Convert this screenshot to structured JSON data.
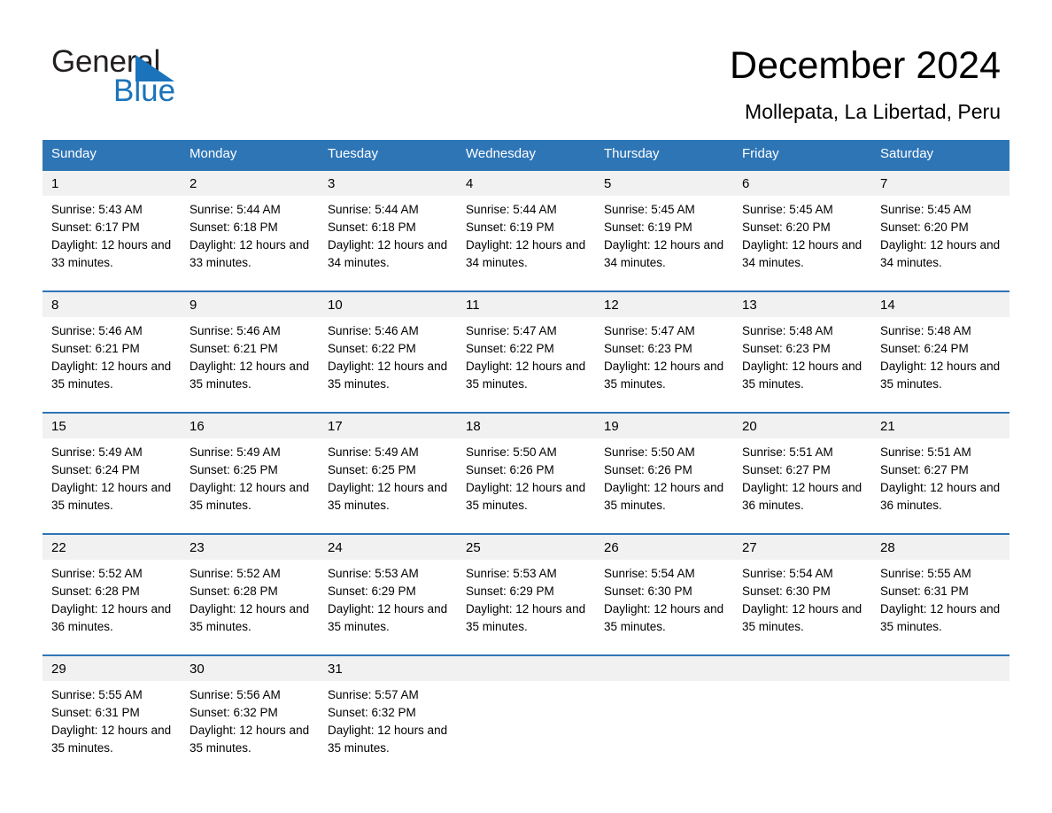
{
  "brand": {
    "name_part1": "General",
    "name_part2": "Blue",
    "triangle_color": "#1b74bb"
  },
  "header": {
    "title": "December 2024",
    "subtitle": "Mollepata, La Libertad, Peru"
  },
  "colors": {
    "header_blue": "#2e75b6",
    "daynum_band": "#f1f1f1",
    "text": "#000000"
  },
  "weekdays": [
    "Sunday",
    "Monday",
    "Tuesday",
    "Wednesday",
    "Thursday",
    "Friday",
    "Saturday"
  ],
  "weeks": [
    {
      "days": [
        {
          "num": "1",
          "sunrise": "Sunrise: 5:43 AM",
          "sunset": "Sunset: 6:17 PM",
          "daylight": "Daylight: 12 hours and 33 minutes."
        },
        {
          "num": "2",
          "sunrise": "Sunrise: 5:44 AM",
          "sunset": "Sunset: 6:18 PM",
          "daylight": "Daylight: 12 hours and 33 minutes."
        },
        {
          "num": "3",
          "sunrise": "Sunrise: 5:44 AM",
          "sunset": "Sunset: 6:18 PM",
          "daylight": "Daylight: 12 hours and 34 minutes."
        },
        {
          "num": "4",
          "sunrise": "Sunrise: 5:44 AM",
          "sunset": "Sunset: 6:19 PM",
          "daylight": "Daylight: 12 hours and 34 minutes."
        },
        {
          "num": "5",
          "sunrise": "Sunrise: 5:45 AM",
          "sunset": "Sunset: 6:19 PM",
          "daylight": "Daylight: 12 hours and 34 minutes."
        },
        {
          "num": "6",
          "sunrise": "Sunrise: 5:45 AM",
          "sunset": "Sunset: 6:20 PM",
          "daylight": "Daylight: 12 hours and 34 minutes."
        },
        {
          "num": "7",
          "sunrise": "Sunrise: 5:45 AM",
          "sunset": "Sunset: 6:20 PM",
          "daylight": "Daylight: 12 hours and 34 minutes."
        }
      ]
    },
    {
      "days": [
        {
          "num": "8",
          "sunrise": "Sunrise: 5:46 AM",
          "sunset": "Sunset: 6:21 PM",
          "daylight": "Daylight: 12 hours and 35 minutes."
        },
        {
          "num": "9",
          "sunrise": "Sunrise: 5:46 AM",
          "sunset": "Sunset: 6:21 PM",
          "daylight": "Daylight: 12 hours and 35 minutes."
        },
        {
          "num": "10",
          "sunrise": "Sunrise: 5:46 AM",
          "sunset": "Sunset: 6:22 PM",
          "daylight": "Daylight: 12 hours and 35 minutes."
        },
        {
          "num": "11",
          "sunrise": "Sunrise: 5:47 AM",
          "sunset": "Sunset: 6:22 PM",
          "daylight": "Daylight: 12 hours and 35 minutes."
        },
        {
          "num": "12",
          "sunrise": "Sunrise: 5:47 AM",
          "sunset": "Sunset: 6:23 PM",
          "daylight": "Daylight: 12 hours and 35 minutes."
        },
        {
          "num": "13",
          "sunrise": "Sunrise: 5:48 AM",
          "sunset": "Sunset: 6:23 PM",
          "daylight": "Daylight: 12 hours and 35 minutes."
        },
        {
          "num": "14",
          "sunrise": "Sunrise: 5:48 AM",
          "sunset": "Sunset: 6:24 PM",
          "daylight": "Daylight: 12 hours and 35 minutes."
        }
      ]
    },
    {
      "days": [
        {
          "num": "15",
          "sunrise": "Sunrise: 5:49 AM",
          "sunset": "Sunset: 6:24 PM",
          "daylight": "Daylight: 12 hours and 35 minutes."
        },
        {
          "num": "16",
          "sunrise": "Sunrise: 5:49 AM",
          "sunset": "Sunset: 6:25 PM",
          "daylight": "Daylight: 12 hours and 35 minutes."
        },
        {
          "num": "17",
          "sunrise": "Sunrise: 5:49 AM",
          "sunset": "Sunset: 6:25 PM",
          "daylight": "Daylight: 12 hours and 35 minutes."
        },
        {
          "num": "18",
          "sunrise": "Sunrise: 5:50 AM",
          "sunset": "Sunset: 6:26 PM",
          "daylight": "Daylight: 12 hours and 35 minutes."
        },
        {
          "num": "19",
          "sunrise": "Sunrise: 5:50 AM",
          "sunset": "Sunset: 6:26 PM",
          "daylight": "Daylight: 12 hours and 35 minutes."
        },
        {
          "num": "20",
          "sunrise": "Sunrise: 5:51 AM",
          "sunset": "Sunset: 6:27 PM",
          "daylight": "Daylight: 12 hours and 36 minutes."
        },
        {
          "num": "21",
          "sunrise": "Sunrise: 5:51 AM",
          "sunset": "Sunset: 6:27 PM",
          "daylight": "Daylight: 12 hours and 36 minutes."
        }
      ]
    },
    {
      "days": [
        {
          "num": "22",
          "sunrise": "Sunrise: 5:52 AM",
          "sunset": "Sunset: 6:28 PM",
          "daylight": "Daylight: 12 hours and 36 minutes."
        },
        {
          "num": "23",
          "sunrise": "Sunrise: 5:52 AM",
          "sunset": "Sunset: 6:28 PM",
          "daylight": "Daylight: 12 hours and 35 minutes."
        },
        {
          "num": "24",
          "sunrise": "Sunrise: 5:53 AM",
          "sunset": "Sunset: 6:29 PM",
          "daylight": "Daylight: 12 hours and 35 minutes."
        },
        {
          "num": "25",
          "sunrise": "Sunrise: 5:53 AM",
          "sunset": "Sunset: 6:29 PM",
          "daylight": "Daylight: 12 hours and 35 minutes."
        },
        {
          "num": "26",
          "sunrise": "Sunrise: 5:54 AM",
          "sunset": "Sunset: 6:30 PM",
          "daylight": "Daylight: 12 hours and 35 minutes."
        },
        {
          "num": "27",
          "sunrise": "Sunrise: 5:54 AM",
          "sunset": "Sunset: 6:30 PM",
          "daylight": "Daylight: 12 hours and 35 minutes."
        },
        {
          "num": "28",
          "sunrise": "Sunrise: 5:55 AM",
          "sunset": "Sunset: 6:31 PM",
          "daylight": "Daylight: 12 hours and 35 minutes."
        }
      ]
    },
    {
      "days": [
        {
          "num": "29",
          "sunrise": "Sunrise: 5:55 AM",
          "sunset": "Sunset: 6:31 PM",
          "daylight": "Daylight: 12 hours and 35 minutes."
        },
        {
          "num": "30",
          "sunrise": "Sunrise: 5:56 AM",
          "sunset": "Sunset: 6:32 PM",
          "daylight": "Daylight: 12 hours and 35 minutes."
        },
        {
          "num": "31",
          "sunrise": "Sunrise: 5:57 AM",
          "sunset": "Sunset: 6:32 PM",
          "daylight": "Daylight: 12 hours and 35 minutes."
        },
        {
          "num": "",
          "sunrise": "",
          "sunset": "",
          "daylight": ""
        },
        {
          "num": "",
          "sunrise": "",
          "sunset": "",
          "daylight": ""
        },
        {
          "num": "",
          "sunrise": "",
          "sunset": "",
          "daylight": ""
        },
        {
          "num": "",
          "sunrise": "",
          "sunset": "",
          "daylight": ""
        }
      ]
    }
  ]
}
